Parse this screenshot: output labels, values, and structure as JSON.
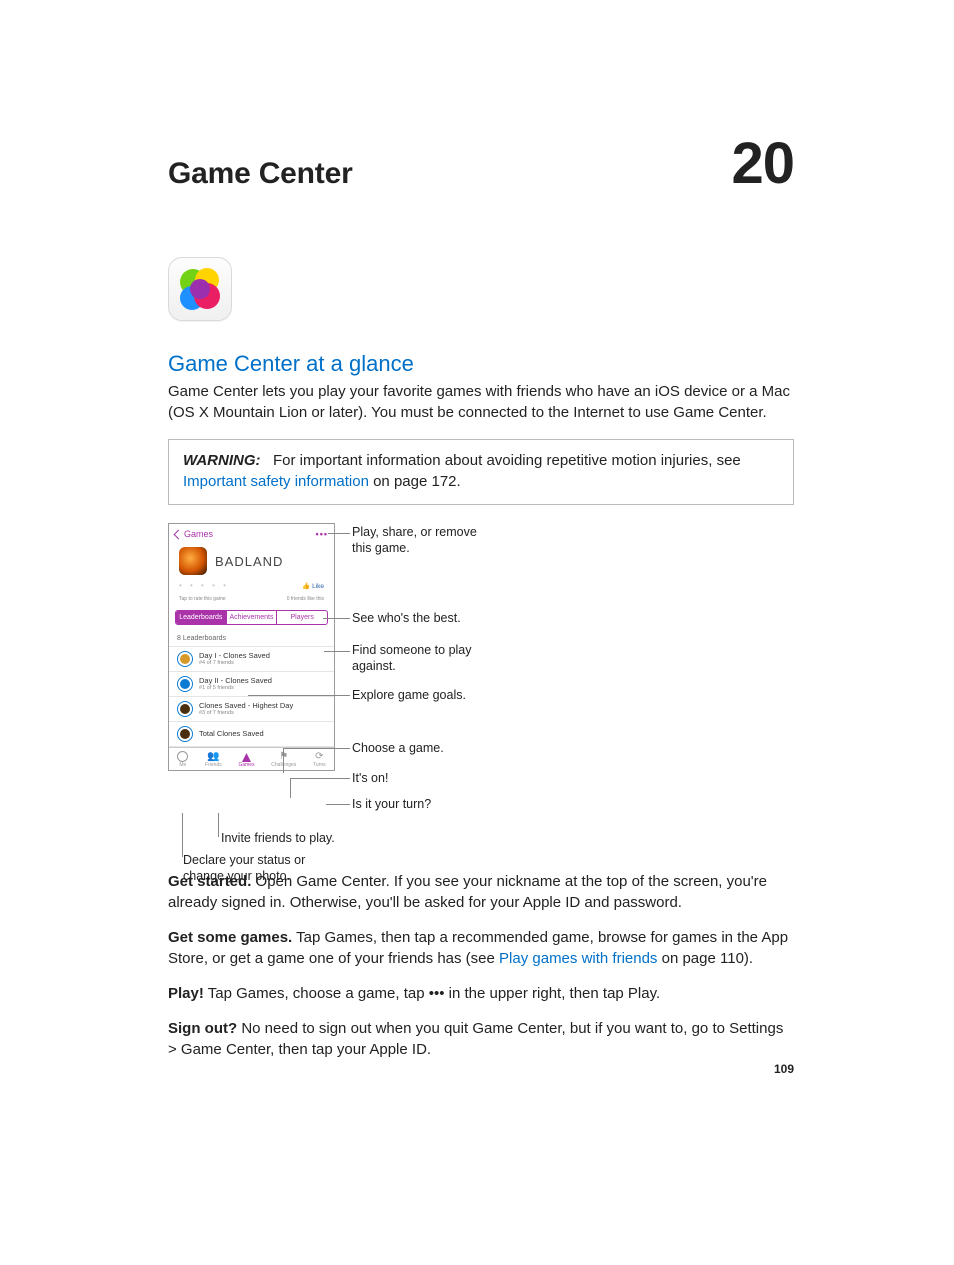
{
  "chapter": {
    "title": "Game Center",
    "number": "20"
  },
  "section": {
    "title": "Game Center at a glance"
  },
  "intro": "Game Center lets you play your favorite games with friends who have an iOS device or a Mac (OS X Mountain Lion or later). You must be connected to the Internet to use Game Center.",
  "warning": {
    "label": "WARNING:",
    "before_link": "For important information about avoiding repetitive motion injuries, see ",
    "link": "Important safety information",
    "after_link": " on page 172."
  },
  "screenshot": {
    "back": "Games",
    "more": "•••",
    "game_title": "BADLAND",
    "like_label": "Like",
    "rate_hint": "Tap to rate this game",
    "fb_hint": "0 friends like this",
    "tabs": {
      "leaderboards": "Leaderboards",
      "achievements": "Achievements",
      "players": "Players"
    },
    "lb_count": "8 Leaderboards",
    "rows": [
      {
        "title": "Day I - Clones Saved",
        "sub": "#4 of 7 friends"
      },
      {
        "title": "Day II - Clones Saved",
        "sub": "#1 of 5 friends"
      },
      {
        "title": "Clones Saved - Highest Day",
        "sub": "#3 of 7 friends"
      },
      {
        "title": "Total Clones Saved",
        "sub": ""
      }
    ],
    "bottom_tabs": {
      "me": "Me",
      "friends": "Friends",
      "games": "Games",
      "challenges": "Challenges",
      "turns": "Turns"
    }
  },
  "callouts": {
    "play_share": "Play, share, or remove this game.",
    "best": "See who's the best.",
    "find": "Find someone to play against.",
    "explore": "Explore game goals.",
    "choose": "Choose a game.",
    "iton": "It's on!",
    "turn": "Is it your turn?",
    "invite": "Invite friends to play.",
    "declare": "Declare your status or change your photo."
  },
  "paragraphs": {
    "p1_lead": "Get started.",
    "p1": " Open Game Center. If you see your nickname at the top of the screen, you're already signed in. Otherwise, you'll be asked for your Apple ID and password.",
    "p2_lead": "Get some games.",
    "p2a": " Tap Games, then tap a recommended game, browse for games in the App Store, or get a game one of your friends has (see ",
    "p2_link": "Play games with friends",
    "p2b": " on page 110).",
    "p3_lead": "Play!",
    "p3": " Tap Games, choose a game, tap ••• in the upper right, then tap Play.",
    "p4_lead": "Sign out?",
    "p4": " No need to sign out when you quit Game Center, but if you want to, go to Settings > Game Center, then tap your Apple ID."
  },
  "page_number": "109"
}
